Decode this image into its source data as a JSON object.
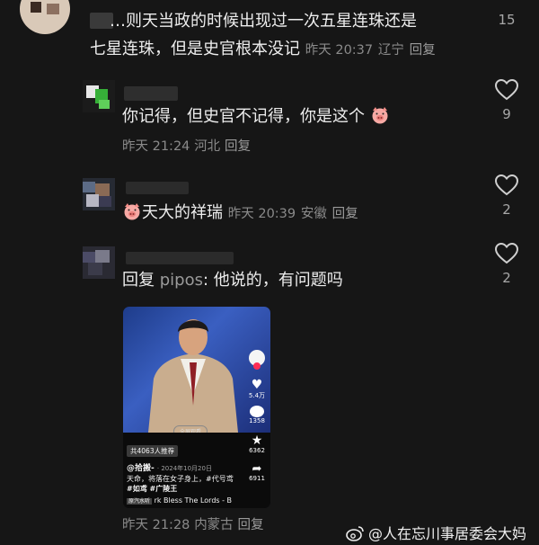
{
  "comments": [
    {
      "text_line1": "…则天当政的时候出现过一次五星连珠还是",
      "text_line2": "七星连珠，但是史官根本没记",
      "time": "昨天 20:37",
      "location": "辽宁",
      "reply_label": "回复",
      "likes": "15",
      "like_icon": "heart-outline-icon"
    },
    {
      "text": "你记得，但史官不记得，你是这个",
      "time": "昨天 21:24",
      "location": "河北",
      "reply_label": "回复",
      "likes": "9",
      "like_icon": "heart-outline-icon"
    },
    {
      "text": "天大的祥瑞",
      "time": "昨天 20:39",
      "location": "安徽",
      "reply_label": "回复",
      "likes": "2",
      "like_icon": "heart-outline-icon"
    },
    {
      "reply_prefix": "回复",
      "reply_to": "pipos",
      "text": ": 他说的，有问题吗",
      "time": "昨天 21:28",
      "location": "内蒙古",
      "reply_label": "回复",
      "likes": "2",
      "like_icon": "heart-outline-icon"
    }
  ],
  "video_card": {
    "fullscreen_label": "全屏观看",
    "recommend_label": "共4063人推荐",
    "author": "@拾搬-",
    "date": "· 2024年10月20日",
    "caption_line1": "天命，将落在女子身上，#代号鸢",
    "caption_line2": "#如鸢 #广陵王",
    "music_tag": "原汽水听",
    "music": "rk    Bless The Lords - B",
    "like_count": "5.4万",
    "comment_count": "1358",
    "favorite_count": "6362",
    "share_count": "6911"
  },
  "watermark": "@人在忘川事居委会大妈",
  "colors": {
    "background": "#161616",
    "meta": "#8a8a8a",
    "text": "#ededed"
  }
}
